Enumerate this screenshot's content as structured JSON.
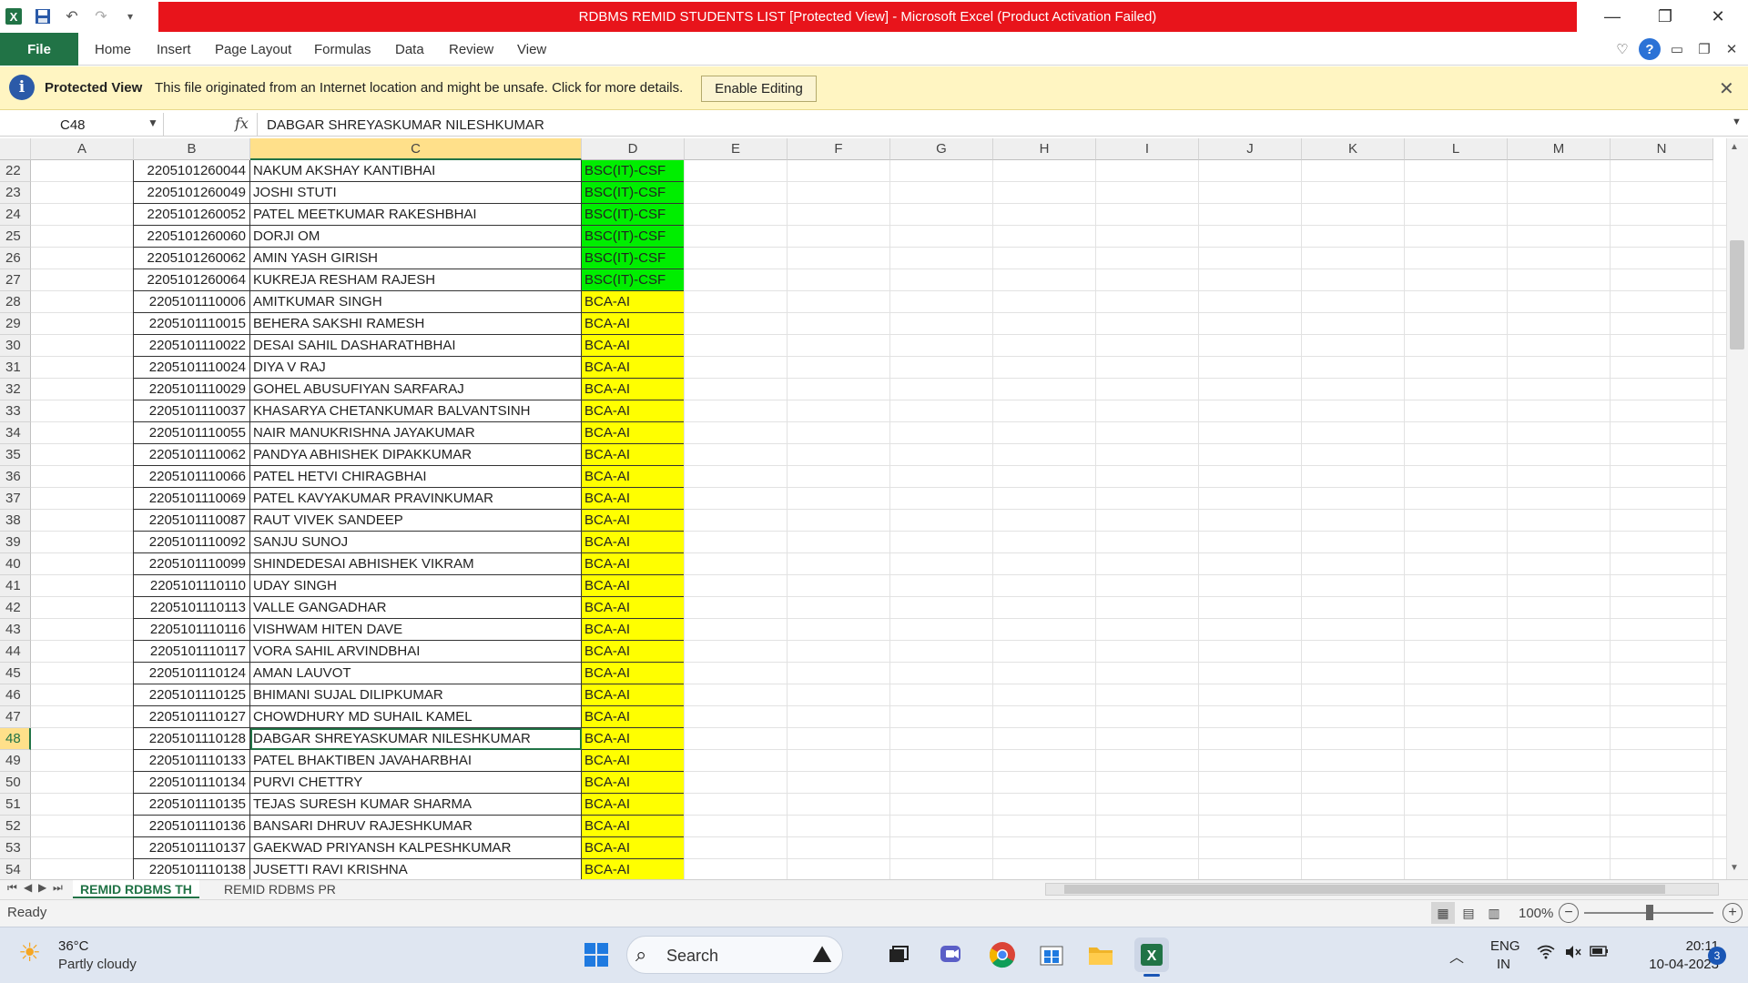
{
  "window": {
    "title": "RDBMS REMID STUDENTS LIST  [Protected View]  -  Microsoft Excel (Product Activation Failed)",
    "minimize": "—",
    "restore": "❐",
    "close": "✕"
  },
  "qat": {
    "excel_icon": "excel-icon",
    "save_icon": "save-icon",
    "undo_icon": "undo-icon",
    "redo_icon": "redo-icon",
    "customize_icon": "customize-icon"
  },
  "ribbon": {
    "file": "File",
    "tabs": [
      "Home",
      "Insert",
      "Page Layout",
      "Formulas",
      "Data",
      "Review",
      "View"
    ]
  },
  "protected_view": {
    "title": "Protected View",
    "message": "This file originated from an Internet location and might be unsafe. Click for more details.",
    "button": "Enable Editing",
    "close": "✕"
  },
  "formula_bar": {
    "name_box": "C48",
    "fx": "fx",
    "content": "DABGAR SHREYASKUMAR NILESHKUMAR"
  },
  "columns": [
    "A",
    "B",
    "C",
    "D",
    "E",
    "F",
    "G",
    "H",
    "I",
    "J",
    "K",
    "L",
    "M",
    "N"
  ],
  "active_cell": {
    "column": "C",
    "row": "48"
  },
  "colors": {
    "bsc_fill": "#00ee00",
    "bca_fill": "#ffff00",
    "excel_green": "#217346",
    "title_red": "#e8141b"
  },
  "rows": [
    {
      "row": "22",
      "id": "2205101260044",
      "name": "NAKUM AKSHAY KANTIBHAI",
      "course": "BSC(IT)-CSF"
    },
    {
      "row": "23",
      "id": "2205101260049",
      "name": "JOSHI STUTI",
      "course": "BSC(IT)-CSF"
    },
    {
      "row": "24",
      "id": "2205101260052",
      "name": "PATEL MEETKUMAR RAKESHBHAI",
      "course": "BSC(IT)-CSF"
    },
    {
      "row": "25",
      "id": "2205101260060",
      "name": "DORJI OM",
      "course": "BSC(IT)-CSF"
    },
    {
      "row": "26",
      "id": "2205101260062",
      "name": "AMIN YASH GIRISH",
      "course": "BSC(IT)-CSF"
    },
    {
      "row": "27",
      "id": "2205101260064",
      "name": "KUKREJA RESHAM RAJESH",
      "course": "BSC(IT)-CSF"
    },
    {
      "row": "28",
      "id": "2205101110006",
      "name": "AMITKUMAR SINGH",
      "course": "BCA-AI"
    },
    {
      "row": "29",
      "id": "2205101110015",
      "name": "BEHERA SAKSHI RAMESH",
      "course": "BCA-AI"
    },
    {
      "row": "30",
      "id": "2205101110022",
      "name": "DESAI SAHIL DASHARATHBHAI",
      "course": "BCA-AI"
    },
    {
      "row": "31",
      "id": "2205101110024",
      "name": "DIYA V RAJ",
      "course": "BCA-AI"
    },
    {
      "row": "32",
      "id": "2205101110029",
      "name": "GOHEL ABUSUFIYAN SARFARAJ",
      "course": "BCA-AI"
    },
    {
      "row": "33",
      "id": "2205101110037",
      "name": "KHASARYA CHETANKUMAR BALVANTSINH",
      "course": "BCA-AI"
    },
    {
      "row": "34",
      "id": "2205101110055",
      "name": "NAIR MANUKRISHNA JAYAKUMAR",
      "course": "BCA-AI"
    },
    {
      "row": "35",
      "id": "2205101110062",
      "name": "PANDYA ABHISHEK DIPAKKUMAR",
      "course": "BCA-AI"
    },
    {
      "row": "36",
      "id": "2205101110066",
      "name": "PATEL HETVI CHIRAGBHAI",
      "course": "BCA-AI"
    },
    {
      "row": "37",
      "id": "2205101110069",
      "name": "PATEL KAVYAKUMAR PRAVINKUMAR",
      "course": "BCA-AI"
    },
    {
      "row": "38",
      "id": "2205101110087",
      "name": "RAUT VIVEK SANDEEP",
      "course": "BCA-AI"
    },
    {
      "row": "39",
      "id": "2205101110092",
      "name": "SANJU SUNOJ",
      "course": "BCA-AI"
    },
    {
      "row": "40",
      "id": "2205101110099",
      "name": "SHINDEDESAI ABHISHEK VIKRAM",
      "course": "BCA-AI"
    },
    {
      "row": "41",
      "id": "2205101110110",
      "name": "UDAY SINGH",
      "course": "BCA-AI"
    },
    {
      "row": "42",
      "id": "2205101110113",
      "name": "VALLE GANGADHAR",
      "course": "BCA-AI"
    },
    {
      "row": "43",
      "id": "2205101110116",
      "name": "VISHWAM HITEN DAVE",
      "course": "BCA-AI"
    },
    {
      "row": "44",
      "id": "2205101110117",
      "name": "VORA SAHIL ARVINDBHAI",
      "course": "BCA-AI"
    },
    {
      "row": "45",
      "id": "2205101110124",
      "name": "AMAN LAUVOT",
      "course": "BCA-AI"
    },
    {
      "row": "46",
      "id": "2205101110125",
      "name": "BHIMANI SUJAL DILIPKUMAR",
      "course": "BCA-AI"
    },
    {
      "row": "47",
      "id": "2205101110127",
      "name": "CHOWDHURY MD SUHAIL KAMEL",
      "course": "BCA-AI"
    },
    {
      "row": "48",
      "id": "2205101110128",
      "name": "DABGAR SHREYASKUMAR NILESHKUMAR",
      "course": "BCA-AI"
    },
    {
      "row": "49",
      "id": "2205101110133",
      "name": "PATEL BHAKTIBEN JAVAHARBHAI",
      "course": "BCA-AI"
    },
    {
      "row": "50",
      "id": "2205101110134",
      "name": "PURVI CHETTRY",
      "course": "BCA-AI"
    },
    {
      "row": "51",
      "id": "2205101110135",
      "name": "TEJAS SURESH KUMAR SHARMA",
      "course": "BCA-AI"
    },
    {
      "row": "52",
      "id": "2205101110136",
      "name": "BANSARI DHRUV RAJESHKUMAR",
      "course": "BCA-AI"
    },
    {
      "row": "53",
      "id": "2205101110137",
      "name": "GAEKWAD PRIYANSH KALPESHKUMAR",
      "course": "BCA-AI"
    },
    {
      "row": "54",
      "id": "2205101110138",
      "name": "JUSETTI RAVI KRISHNA",
      "course": "BCA-AI"
    }
  ],
  "sheet_tabs": [
    "REMID RDBMS TH",
    "REMID RDBMS PR"
  ],
  "status": {
    "ready": "Ready",
    "zoom": "100%",
    "zoom_out": "−",
    "zoom_in": "+"
  },
  "taskbar": {
    "weather_temp": "36°C",
    "weather_desc": "Partly cloudy",
    "search": "Search",
    "lang_line1": "ENG",
    "lang_line2": "IN",
    "time": "20:11",
    "date": "10-04-2023",
    "notifications": "3"
  }
}
